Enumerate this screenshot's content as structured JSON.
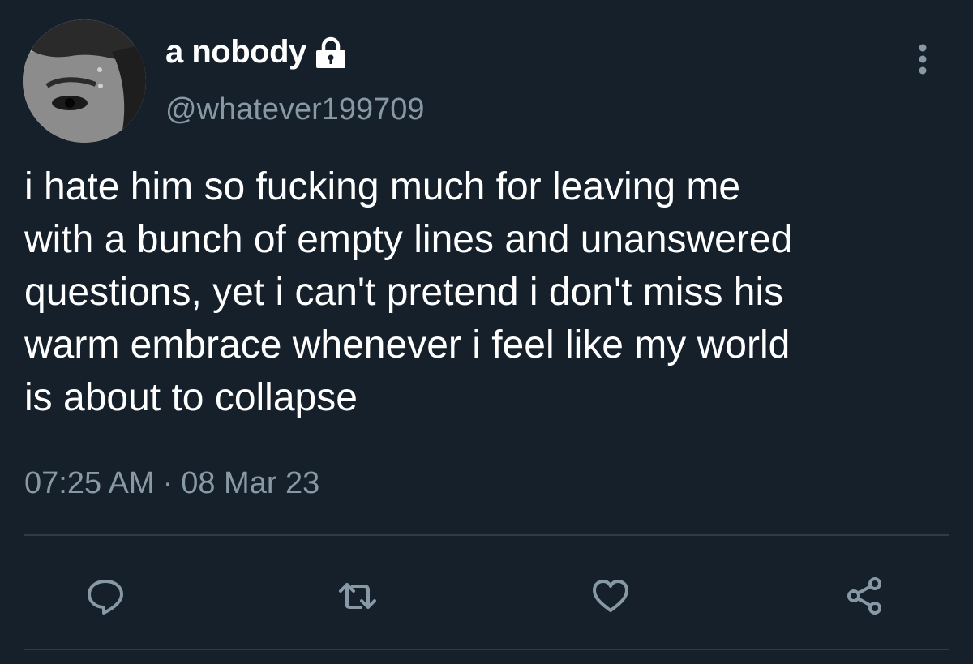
{
  "tweet": {
    "display_name": "a nobody",
    "handle": "@whatever199709",
    "text": "i hate him so fucking much for leaving me\nwith a bunch of empty lines and unanswered\nquestions, yet i can't pretend i don't miss his\nwarm embrace whenever i feel like my world\nis about to collapse",
    "time": "07:25 AM",
    "separator": "·",
    "date": "08 Mar 23",
    "protected_icon": "lock-icon"
  },
  "actions": [
    "reply-icon",
    "retweet-icon",
    "like-icon",
    "share-icon"
  ],
  "colors": {
    "background": "#15202b",
    "primary_text": "#ffffff",
    "secondary_text": "#8899a6",
    "icon": "#8899a6",
    "divider": "#2f3b47"
  }
}
